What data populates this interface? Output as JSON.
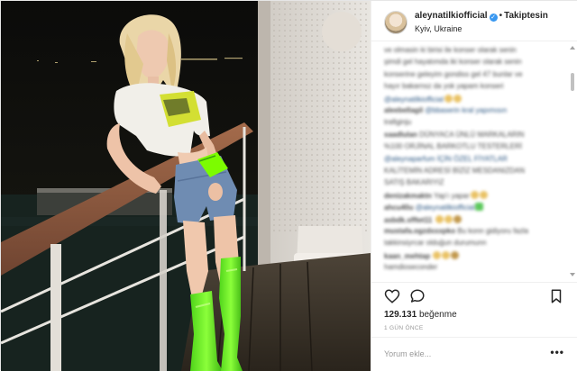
{
  "post": {
    "username": "aleynatilkiofficial",
    "dot": "•",
    "follow_status": "Takiptesin",
    "location": "Kyiv, Ukraine"
  },
  "comments": [
    {
      "user": "",
      "text": "ve olmasin ki birisi ile konser olarak senin"
    },
    {
      "user": "",
      "text": "şimdi gel hayatımda iki konser olarak senin"
    },
    {
      "user": "",
      "text": "konserine geleyim gondiss gel 47 bunlar ve"
    },
    {
      "user": "",
      "text": "hayır bakarnsz da yok yapam konseri"
    },
    {
      "user": "",
      "text": "@aleynatilkiofficial",
      "emoji": 2
    },
    {
      "user": "aleebellagil",
      "text": "@bbaserin kral yapımısın"
    },
    {
      "user": "",
      "text": "trafiginju"
    },
    {
      "user": "saadlulan",
      "text": "DÜNYACA ÜNLÜ MARKALARIN"
    },
    {
      "user": "",
      "text": "%100 ORJİNAL BARKOTLU TESTERLERİ"
    },
    {
      "user": "",
      "text": "@aleynaparfum İÇİN ÖZEL FİYATLAR"
    },
    {
      "user": "",
      "text": "KALİTEMİN ADRESİ BİZİZ MESDANIZDAN"
    },
    {
      "user": "",
      "text": "SATIŞ BAKARIYIZ"
    },
    {
      "user": "denizakmaktn",
      "text": "Yap'ı yapar",
      "emoji": 2
    },
    {
      "user": "ahcu40u",
      "text": "@aleynatilkiofficial",
      "emoji": 1
    },
    {
      "user": "asbdk.sfftet11",
      "text": "",
      "emoji": 3
    },
    {
      "user": "mustafa.ogzdxxxpko",
      "text": "Bu konn gidiyoru fazla"
    },
    {
      "user": "",
      "text": "takkinsiyrcar olduğun durumunn"
    },
    {
      "user": "kaan_mehtap",
      "text": "",
      "emoji": 3
    },
    {
      "user": "",
      "text": "hamdioseconder"
    }
  ],
  "likes": {
    "count": "129.131",
    "label": "beğenme"
  },
  "time_ago": "1 GÜN ÖNCE",
  "comment_input": {
    "placeholder": "Yorum ekle..."
  },
  "more_options": "•••",
  "colors": {
    "accent_blue": "#3897f0",
    "neon_green": "#7CFC00",
    "text": "#262626",
    "muted": "#999999"
  },
  "icons": [
    "verified-badge-icon",
    "heart-icon",
    "comment-bubble-icon",
    "bookmark-icon",
    "more-options-icon"
  ]
}
